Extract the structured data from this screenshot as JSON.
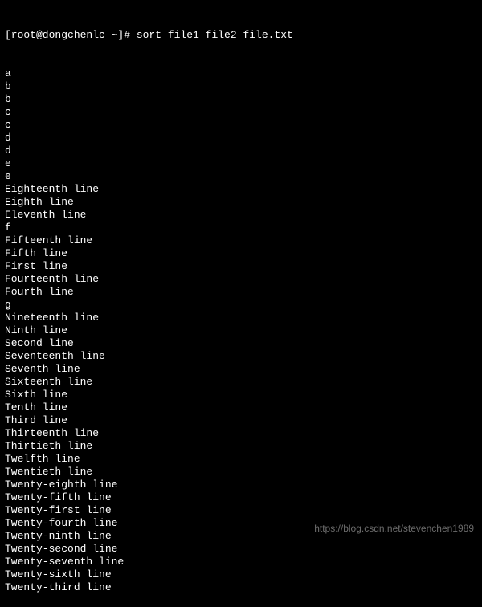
{
  "terminal": {
    "prompt": "[root@dongchenlc ~]# ",
    "command": "sort file1 file2 file.txt",
    "output": [
      "a",
      "b",
      "b",
      "c",
      "c",
      "d",
      "d",
      "e",
      "e",
      "Eighteenth line",
      "Eighth line",
      "Eleventh line",
      "f",
      "Fifteenth line",
      "Fifth line",
      "First line",
      "Fourteenth line",
      "Fourth line",
      "g",
      "Nineteenth line",
      "Ninth line",
      "Second line",
      "Seventeenth line",
      "Seventh line",
      "Sixteenth line",
      "Sixth line",
      "Tenth line",
      "Third line",
      "Thirteenth line",
      "Thirtieth line",
      "Twelfth line",
      "Twentieth line",
      "Twenty-eighth line",
      "Twenty-fifth line",
      "Twenty-first line",
      "Twenty-fourth line",
      "Twenty-ninth line",
      "Twenty-second line",
      "Twenty-seventh line",
      "Twenty-sixth line",
      "Twenty-third line"
    ]
  },
  "watermark": "https://blog.csdn.net/stevenchen1989"
}
